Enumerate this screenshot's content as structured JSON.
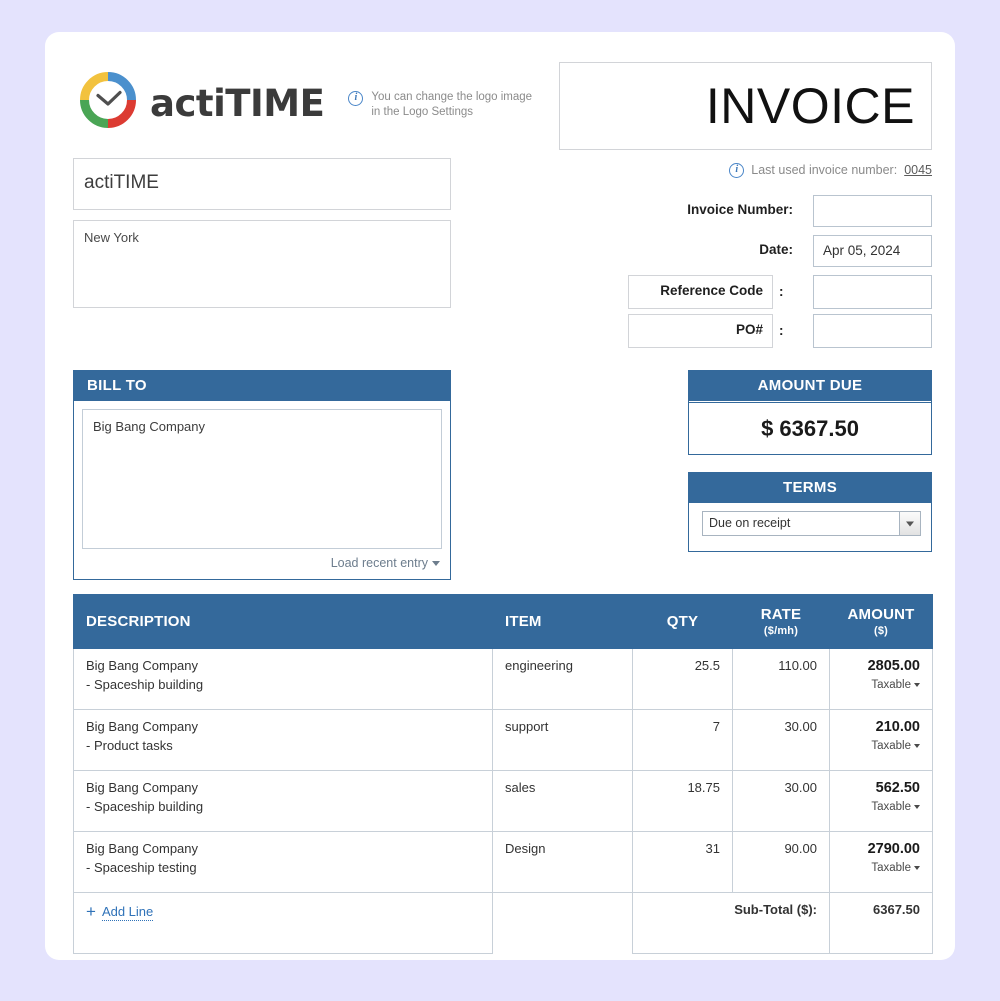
{
  "brand": {
    "name": "actiTIME",
    "logo_colors": {
      "top_left": "#f2c23e",
      "top_right": "#4b90cd",
      "bottom_right": "#dc3b32",
      "bottom_left": "#4aa555"
    },
    "accent_blue": "#34699b",
    "page_background": "#e4e3fd"
  },
  "logo_hint": {
    "icon": "info-icon",
    "line1": "You can change the logo image",
    "line2": "in the Logo Settings"
  },
  "sender": {
    "name": "actiTIME",
    "address": "New York"
  },
  "header": {
    "title": "INVOICE"
  },
  "last_used": {
    "icon": "info-icon",
    "label": "Last used invoice number:",
    "value": "0045"
  },
  "meta": {
    "invoice_number": {
      "label": "Invoice Number:",
      "value": ""
    },
    "date": {
      "label": "Date:",
      "value": "Apr 05, 2024"
    },
    "reference_code": {
      "label": "Reference Code",
      "colon": ":",
      "value": ""
    },
    "po": {
      "label": "PO#",
      "colon": ":",
      "value": ""
    }
  },
  "bill_to": {
    "heading": "BILL TO",
    "value": "Big Bang Company",
    "load_recent_label": "Load recent entry"
  },
  "amount_due": {
    "heading": "AMOUNT DUE",
    "value": "$ 6367.50"
  },
  "terms": {
    "heading": "TERMS",
    "selected": "Due on receipt"
  },
  "table": {
    "columns": [
      {
        "label": "DESCRIPTION",
        "sub": ""
      },
      {
        "label": "ITEM",
        "sub": ""
      },
      {
        "label": "QTY",
        "sub": ""
      },
      {
        "label": "RATE",
        "sub": "($/mh)"
      },
      {
        "label": "AMOUNT",
        "sub": "($)"
      }
    ],
    "rows": [
      {
        "desc_line1": "Big Bang Company",
        "desc_line2": "- Spaceship building",
        "item": "engineering",
        "qty": "25.5",
        "rate": "110.00",
        "amount": "2805.00",
        "tax": "Taxable"
      },
      {
        "desc_line1": "Big Bang Company",
        "desc_line2": "- Product tasks",
        "item": "support",
        "qty": "7",
        "rate": "30.00",
        "amount": "210.00",
        "tax": "Taxable"
      },
      {
        "desc_line1": "Big Bang Company",
        "desc_line2": "- Spaceship building",
        "item": "sales",
        "qty": "18.75",
        "rate": "30.00",
        "amount": "562.50",
        "tax": "Taxable"
      },
      {
        "desc_line1": "Big Bang Company",
        "desc_line2": "- Spaceship testing",
        "item": "Design",
        "qty": "31",
        "rate": "90.00",
        "amount": "2790.00",
        "tax": "Taxable"
      }
    ],
    "add_line_label": "Add Line",
    "subtotal_label": "Sub-Total ($):",
    "subtotal_value": "6367.50"
  }
}
